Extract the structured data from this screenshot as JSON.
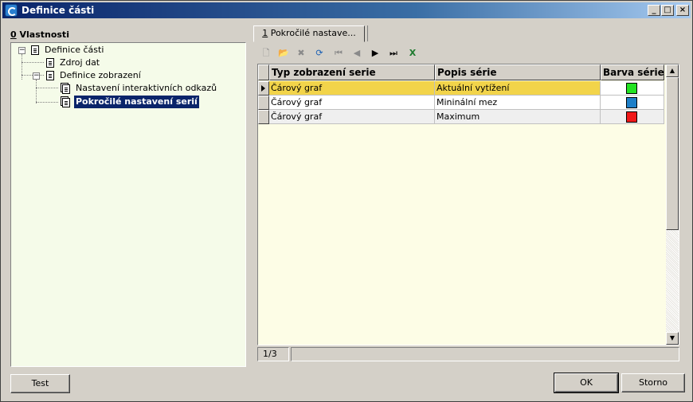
{
  "window": {
    "title": "Definice části",
    "controls": {
      "minimize": "_",
      "maximize": "□",
      "close": "×"
    }
  },
  "left_panel": {
    "label_prefix": "0",
    "label": " Vlastnosti",
    "tree": [
      {
        "label": "Definice části",
        "expanded": true,
        "icon": "document-icon"
      },
      {
        "label": "Zdroj dat",
        "icon": "document-icon"
      },
      {
        "label": "Definice zobrazení",
        "expanded": true,
        "icon": "document-icon"
      },
      {
        "label": "Nastavení interaktivních odkazů",
        "icon": "documents-icon"
      },
      {
        "label": "Pokročilé nastavení serií",
        "icon": "documents-icon",
        "selected": true
      }
    ]
  },
  "tab": {
    "number": "1",
    "label": " Pokročilé nastave..."
  },
  "toolbar": {
    "icons": [
      "new-record-icon",
      "open-icon",
      "delete-icon",
      "refresh-icon",
      "first-record-icon",
      "previous-record-icon",
      "next-record-icon",
      "last-record-icon",
      "excel-export-icon"
    ]
  },
  "grid": {
    "columns": [
      "Typ zobrazení serie",
      "Popis série",
      "Barva série"
    ],
    "rows": [
      {
        "type": "Čárový graf",
        "description": "Aktuální vytížení",
        "color": "#22e322",
        "selected": true
      },
      {
        "type": "Čárový graf",
        "description": "Mininální mez",
        "color": "#1e7fc8"
      },
      {
        "type": "Čárový graf",
        "description": "Maximum",
        "color": "#f01818"
      }
    ]
  },
  "status": {
    "position": "1/3"
  },
  "buttons": {
    "test": "Test",
    "ok": "OK",
    "cancel": "Storno"
  }
}
